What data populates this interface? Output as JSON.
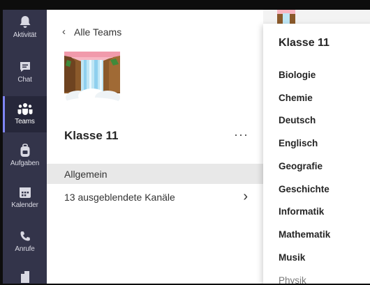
{
  "rail": {
    "items": [
      {
        "label": "Aktivität",
        "icon": "bell-icon"
      },
      {
        "label": "Chat",
        "icon": "chat-icon"
      },
      {
        "label": "Teams",
        "icon": "teams-icon"
      },
      {
        "label": "Aufgaben",
        "icon": "backpack-icon"
      },
      {
        "label": "Kalender",
        "icon": "calendar-icon"
      },
      {
        "label": "Anrufe",
        "icon": "phone-icon"
      },
      {
        "label": "",
        "icon": "file-icon"
      }
    ],
    "active": "Teams",
    "accent_color": "#7f85f5"
  },
  "team_pane": {
    "back_label": "Alle Teams",
    "team_name": "Klasse 11",
    "more_label": "···",
    "channels": {
      "general": "Allgemein",
      "hidden": "13 ausgeblendete Kanäle"
    }
  },
  "dropdown": {
    "title": "Klasse 11",
    "items": [
      "Biologie",
      "Chemie",
      "Deutsch",
      "Englisch",
      "Geografie",
      "Geschichte",
      "Informatik",
      "Mathematik",
      "Musik",
      "Physik"
    ]
  }
}
